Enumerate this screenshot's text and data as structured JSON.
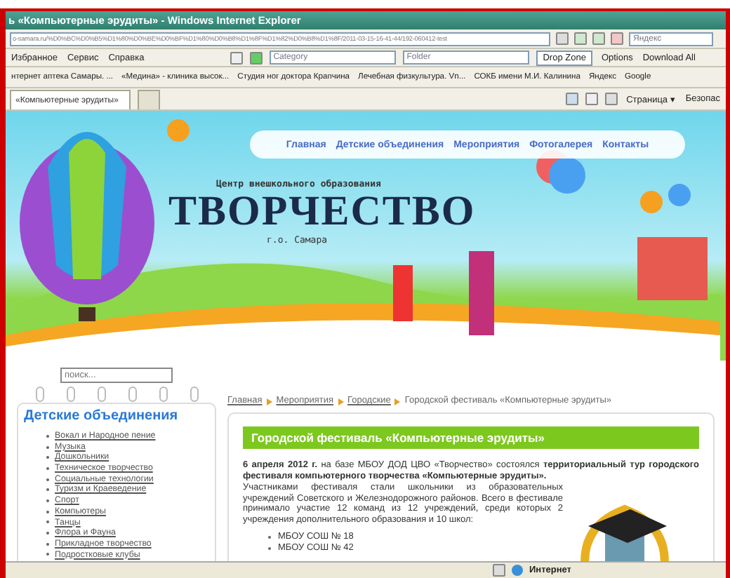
{
  "window": {
    "title": "ь «Компьютерные эрудиты» - Windows Internet Explorer"
  },
  "address_bar": {
    "url": "o-samara.ru/%D0%BC%D0%B5%D1%80%D0%BE%D0%BF%D1%80%D0%B8%D1%8F%D1%82%D0%B8%D1%8F/2011-03-15-16-41-44/192-060412-test",
    "search_placeholder": "Яндекс"
  },
  "menu": [
    "Избранное",
    "Сервис",
    "Справка"
  ],
  "toolbar": {
    "category_label": "Category",
    "folder_label": "Folder",
    "buttons": [
      "Drop Zone",
      "Options",
      "Download All"
    ]
  },
  "favorites": [
    "нтернет аптека Самары. ...",
    "«Медина» - клиника высок...",
    "Студия ног доктора Крапчина",
    "Лечебная физкультура. Vn...",
    "СОКБ имени М.И. Калинина",
    "Яндекс",
    "Google"
  ],
  "tabs": [
    {
      "label": "«Компьютерные эрудиты»",
      "selected": true
    }
  ],
  "command_bar": [
    "Страница ▾",
    "Безопас"
  ],
  "page": {
    "nav": [
      "Главная",
      "Детские объединения",
      "Мероприятия",
      "Фотогалерея",
      "Контакты"
    ],
    "logo": {
      "subtitle": "Центр внешкольного образования",
      "title": "ТВОРЧЕСТВО",
      "city": "г.о. Самара"
    },
    "search": {
      "placeholder": "поиск..."
    },
    "sidebar": {
      "heading": "Детские объединения",
      "items": [
        "Вокал и Народное пение",
        "Музыка",
        "Дошкольники",
        "Техническое творчество",
        "Социальные технологии",
        "Туризм и Краеведение",
        "Спорт",
        "Компьютеры",
        "Танцы",
        "Флора и Фауна",
        "Прикладное творчество",
        "Подростковые клубы"
      ]
    },
    "breadcrumb": [
      "Главная",
      "Мероприятия",
      "Городские",
      "Городской фестиваль «Компьютерные эрудиты»"
    ],
    "article": {
      "title": "Городской фестиваль «Компьютерные эрудиты»",
      "intro": "**6 апреля 2012 г.** на базе МБОУ ДОД ЦВО «Творчество» состоялся **территориальный тур городского фестиваля компьютерного творчества «Компьютерные эрудиты».**",
      "body": "Участниками фестиваля стали школьники из образовательных учреждений Советского и Железнодорожного районов. Всего в фестивале принимало участие 12 команд из 12 учреждений, среди которых 2 учреждения дополнительного образования и 10 школ:",
      "schools": [
        "МБОУ СОШ № 18",
        "МБОУ СОШ № 42"
      ]
    }
  },
  "status_bar": {
    "zone": "Интернет"
  }
}
